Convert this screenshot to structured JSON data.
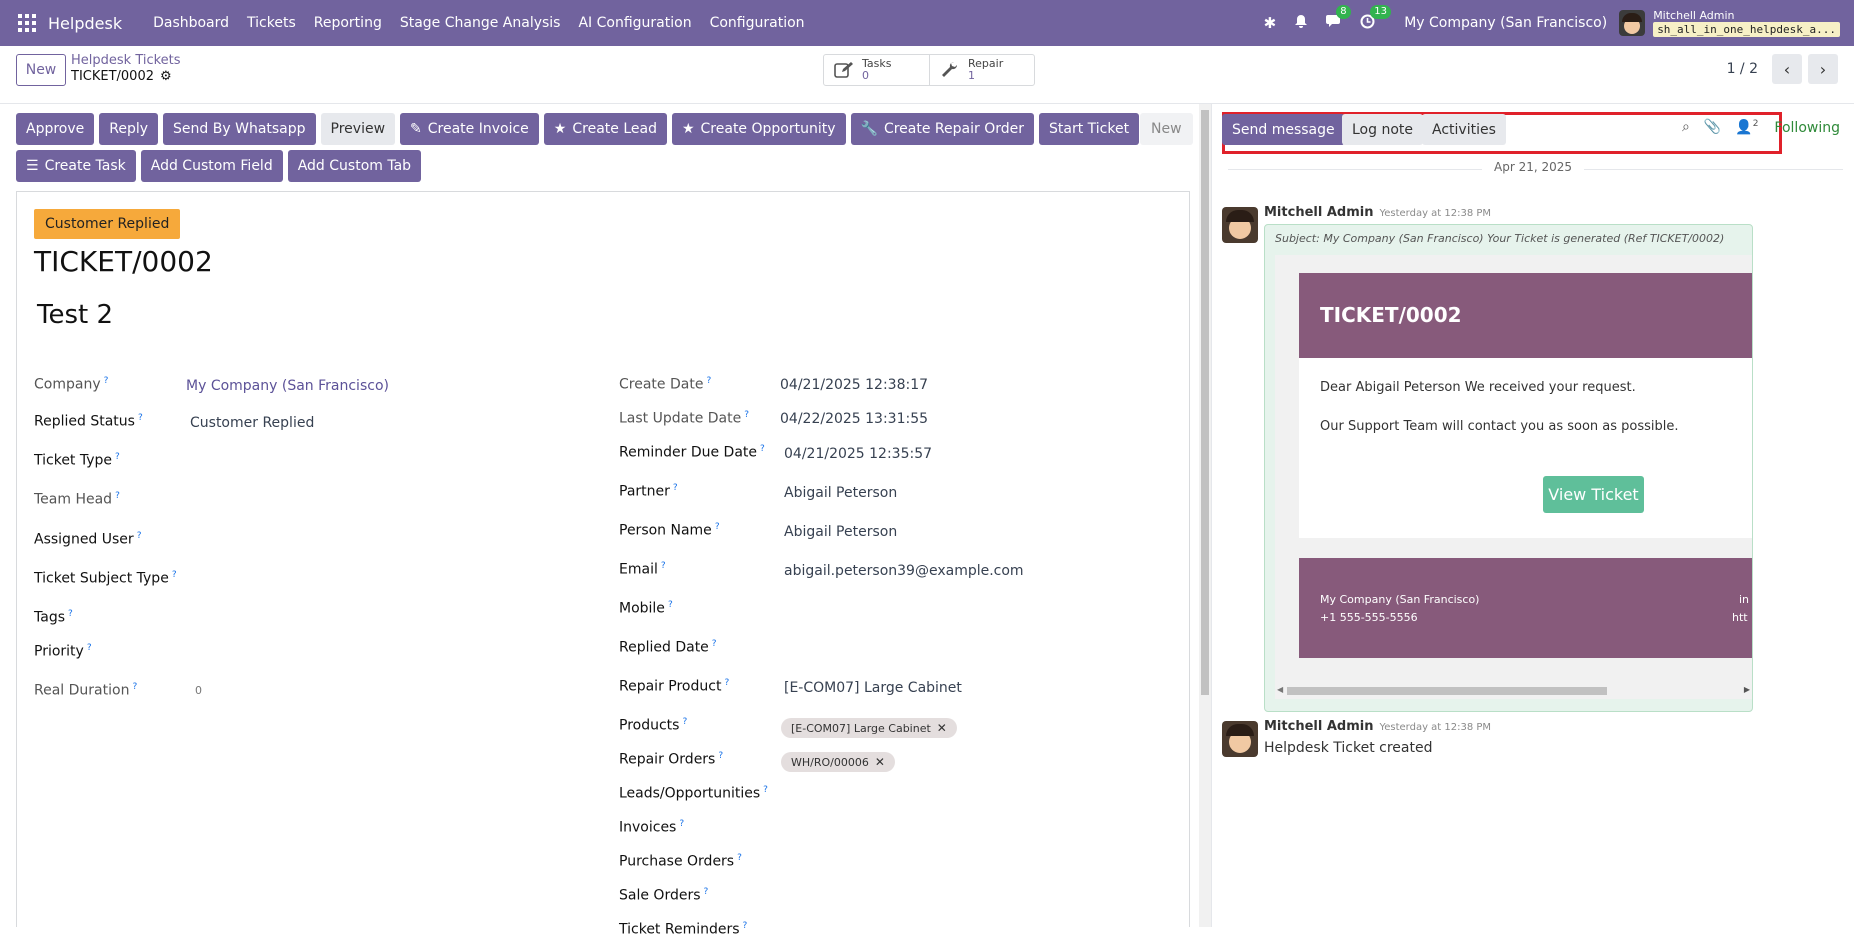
{
  "navbar": {
    "brand": "Helpdesk",
    "menu": [
      "Dashboard",
      "Tickets",
      "Reporting",
      "Stage Change Analysis",
      "AI Configuration",
      "Configuration"
    ],
    "messages_badge": "8",
    "activities_badge": "13",
    "company": "My Company (San Francisco)",
    "user_name": "Mitchell Admin",
    "database": "sh_all_in_one_helpdesk_a..."
  },
  "control": {
    "new_label": "New",
    "breadcrumb_parent": "Helpdesk Tickets",
    "breadcrumb_current": "TICKET/0002",
    "smart_buttons": [
      {
        "label": "Tasks",
        "count": "0"
      },
      {
        "label": "Repair",
        "count": "1"
      }
    ],
    "pager": "1 / 2"
  },
  "actions": {
    "row1": [
      "Approve",
      "Reply",
      "Send By Whatsapp",
      "Preview",
      "Create Invoice",
      "Create Lead",
      "Create Opportunity",
      "Create Repair Order",
      "Start Ticket"
    ],
    "row2": [
      "Create Task",
      "Add Custom Field",
      "Add Custom Tab"
    ],
    "stage": "New"
  },
  "ticket": {
    "ribbon": "Customer Replied",
    "name": "TICKET/0002",
    "subject": "Test 2",
    "left_fields": [
      {
        "label": "Company",
        "value": "My Company (San Francisco)"
      },
      {
        "label": "Replied Status",
        "value": "Customer Replied"
      },
      {
        "label": "Ticket Type",
        "value": ""
      },
      {
        "label": "Team Head",
        "value": ""
      },
      {
        "label": "Assigned User",
        "value": ""
      },
      {
        "label": "Ticket Subject Type",
        "value": ""
      },
      {
        "label": "Tags",
        "value": ""
      },
      {
        "label": "Priority",
        "value": ""
      },
      {
        "label": "Real Duration",
        "value": "0"
      }
    ],
    "right_fields": [
      {
        "label": "Create Date",
        "value": "04/21/2025 12:38:17"
      },
      {
        "label": "Last Update Date",
        "value": "04/22/2025 13:31:55"
      },
      {
        "label": "Reminder Due Date",
        "value": "04/21/2025 12:35:57"
      },
      {
        "label": "Partner",
        "value": "Abigail Peterson"
      },
      {
        "label": "Person Name",
        "value": "Abigail Peterson"
      },
      {
        "label": "Email",
        "value": "abigail.peterson39@example.com"
      },
      {
        "label": "Mobile",
        "value": ""
      },
      {
        "label": "Replied Date",
        "value": ""
      },
      {
        "label": "Repair Product",
        "value": "[E-COM07] Large Cabinet"
      },
      {
        "label": "Products",
        "value": "[E-COM07] Large Cabinet"
      },
      {
        "label": "Repair Orders",
        "value": "WH/RO/00006"
      },
      {
        "label": "Leads/Opportunities",
        "value": ""
      },
      {
        "label": "Invoices",
        "value": ""
      },
      {
        "label": "Purchase Orders",
        "value": ""
      },
      {
        "label": "Sale Orders",
        "value": ""
      },
      {
        "label": "Ticket Reminders",
        "value": ""
      }
    ]
  },
  "chatter": {
    "send_message": "Send message",
    "log_note": "Log note",
    "activities": "Activities",
    "followers_count": "2",
    "following": "Following",
    "date": "Apr 21, 2025",
    "messages": [
      {
        "author": "Mitchell Admin",
        "time": "Yesterday at 12:38 PM",
        "subject": "Subject: My Company (San Francisco) Your Ticket is generated (Ref TICKET/0002)",
        "email_title": "TICKET/0002",
        "line1": "Dear Abigail Peterson We received your request.",
        "line2": "Our Support Team will contact you as soon as possible.",
        "button": "View Ticket",
        "footer_company": "My Company (San Francisco)",
        "footer_phone": "+1 555-555-5556",
        "footer_right1": "in",
        "footer_right2": "htt"
      },
      {
        "author": "Mitchell Admin",
        "time": "Yesterday at 12:38 PM",
        "body": "Helpdesk Ticket created"
      }
    ]
  }
}
